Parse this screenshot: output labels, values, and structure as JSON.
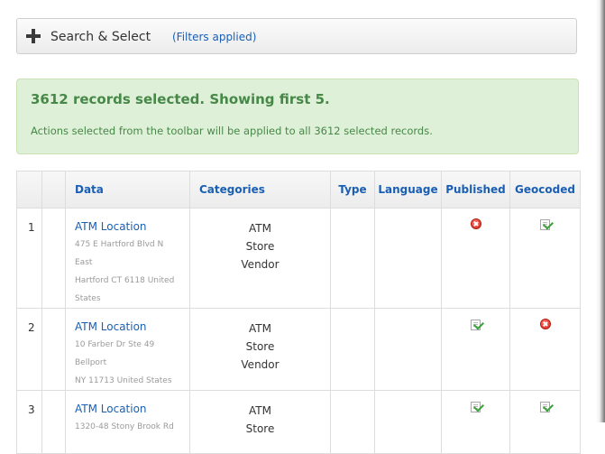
{
  "search_bar": {
    "title": "Search & Select",
    "filters_link": "(Filters applied)"
  },
  "alert": {
    "heading": "3612 records selected. Showing first 5.",
    "text": "Actions selected from the toolbar will be applied to all 3612 selected records."
  },
  "table": {
    "headers": {
      "data": "Data",
      "categories": "Categories",
      "type": "Type",
      "language": "Language",
      "published": "Published",
      "geocoded": "Geocoded"
    },
    "rows": [
      {
        "num": "1",
        "title": "ATM Location",
        "address": [
          "475 E Hartford Blvd N East",
          "Hartford CT 6118 United",
          "States"
        ],
        "categories": [
          "ATM",
          "Store",
          "Vendor"
        ],
        "type": "",
        "language": "",
        "published_icon": "red-x-icon",
        "geocoded_icon": "green-check-icon"
      },
      {
        "num": "2",
        "title": "ATM Location",
        "address": [
          "10 Farber Dr Ste 49 Bellport",
          "NY 11713 United States"
        ],
        "categories": [
          "ATM",
          "Store",
          "Vendor"
        ],
        "type": "",
        "language": "",
        "published_icon": "green-check-icon",
        "geocoded_icon": "red-x-icon"
      },
      {
        "num": "3",
        "title": "ATM Location",
        "address": [
          "1320-48 Stony Brook Rd"
        ],
        "categories": [
          "ATM",
          "Store"
        ],
        "type": "",
        "language": "",
        "published_icon": "green-check-icon",
        "geocoded_icon": "green-check-icon"
      }
    ]
  },
  "colors": {
    "link": "#1a5fb4",
    "alert_bg": "#dff0d8",
    "alert_text": "#468847",
    "error_red": "#d3251a",
    "success_green": "#3aa13a"
  }
}
